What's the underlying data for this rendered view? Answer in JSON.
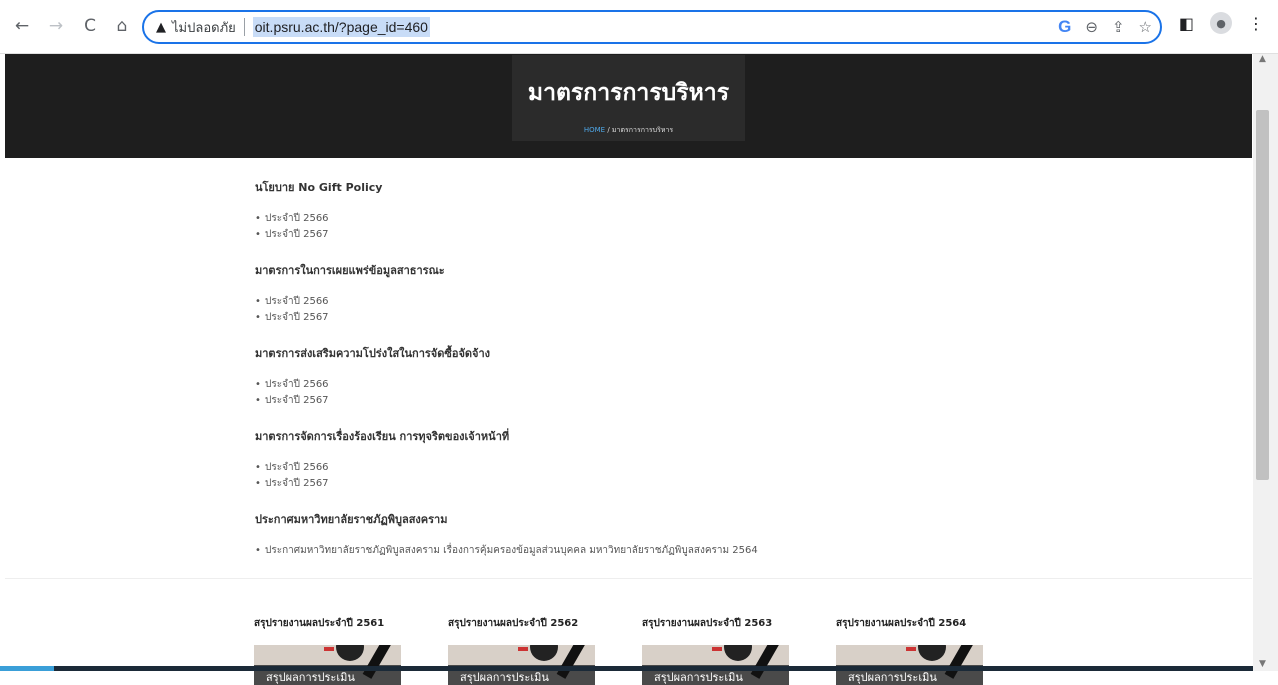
{
  "browser": {
    "security_label": "ไม่ปลอดภัย",
    "url": "oit.psru.ac.th/?page_id=460"
  },
  "hero": {
    "title": "มาตรการการบริหาร",
    "breadcrumb_home": "HOME",
    "breadcrumb_sep": " / ",
    "breadcrumb_current": "มาตรการการบริหาร"
  },
  "sections": [
    {
      "heading": "นโยบาย No Gift Policy",
      "items": [
        {
          "text": "ประจำปี 2566",
          "link": true
        },
        {
          "text": "ประจำปี 2567",
          "link": false
        }
      ]
    },
    {
      "heading": "มาตรการในการเผยแพร่ข้อมูลสาธารณะ",
      "items": [
        {
          "text": "ประจำปี 2566",
          "link": true
        },
        {
          "text": "ประจำปี 2567",
          "link": false
        }
      ]
    },
    {
      "heading": "มาตรการส่งเสริมความโปร่งใสในการจัดซื้อจัดจ้าง",
      "items": [
        {
          "text": "ประจำปี 2566",
          "link": true
        },
        {
          "text": "ประจำปี 2567",
          "link": false
        }
      ]
    },
    {
      "heading": "มาตรการจัดการเรื่องร้องเรียน การทุจริตของเจ้าหน้าที่",
      "items": [
        {
          "text": "ประจำปี 2566",
          "link": true
        },
        {
          "text": "ประจำปี 2567",
          "link": false
        }
      ]
    },
    {
      "heading": "ประกาศมหาวิทยาลัยราชภัฏพิบูลสงคราม",
      "items": [
        {
          "text": "ประกาศมหาวิทยาลัยราชภัฏพิบูลสงคราม เรื่องการคุ้มครองข้อมูลส่วนบุคคล มหาวิทยาลัยราชภัฏพิบูลสงคราม 2564",
          "link": true
        }
      ]
    }
  ],
  "reports": [
    {
      "title": "สรุปรายงานผลประจำปี 2561",
      "thumb_label": "สรุปผลการประเมิน"
    },
    {
      "title": "สรุปรายงานผลประจำปี 2562",
      "thumb_label": "สรุปผลการประเมิน"
    },
    {
      "title": "สรุปรายงานผลประจำปี 2563",
      "thumb_label": "สรุปผลการประเมิน"
    },
    {
      "title": "สรุปรายงานผลประจำปี 2564",
      "thumb_label": "สรุปผลการประเมิน"
    }
  ],
  "colors": {
    "link": "#3a9fd8",
    "hero_bg": "#1e1e1e",
    "omnibox_border": "#1a73e8"
  }
}
